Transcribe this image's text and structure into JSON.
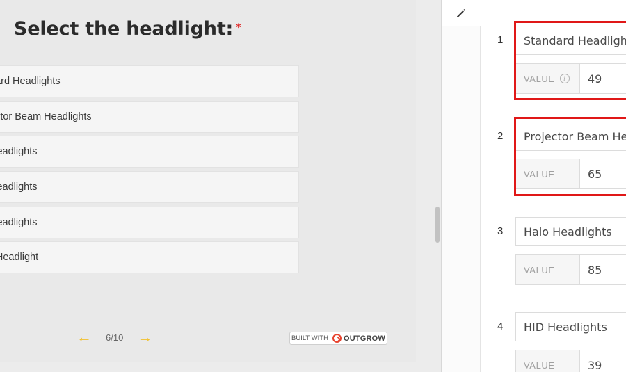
{
  "preview": {
    "question_title": "Select the headlight:",
    "required_marker": "*",
    "options": [
      "Standard Headlights",
      "Projector Beam Headlights",
      "Halo Headlights",
      "HID Headlights",
      "LED Headlights",
      "Laser Headlight"
    ],
    "options_visible": [
      "dard Headlights",
      "ector Beam Headlights",
      " Headlights",
      "Headlights",
      "Headlights",
      "r Headlight"
    ],
    "pager": {
      "prev_icon": "arrow-left-icon",
      "page_text": "6/10",
      "next_icon": "arrow-right-icon"
    },
    "built_with": {
      "prefix": "BUILT WITH",
      "brand": "OUTGROW"
    }
  },
  "editor": {
    "edit_icon": "pencil-icon",
    "value_label": "VALUE",
    "rows": [
      {
        "number": "1",
        "label": "Standard Headligh",
        "value": "49",
        "has_info": true
      },
      {
        "number": "2",
        "label": "Projector Beam He",
        "value": "65",
        "has_info": false
      },
      {
        "number": "3",
        "label": "Halo Headlights",
        "value": "85",
        "has_info": false
      },
      {
        "number": "4",
        "label": "HID Headlights",
        "value": "39",
        "has_info": false
      }
    ],
    "highlight_color": "#e01818"
  },
  "colors": {
    "accent_arrow": "#f2c12e",
    "brand_red": "#e8432e",
    "required_red": "#e02424"
  }
}
